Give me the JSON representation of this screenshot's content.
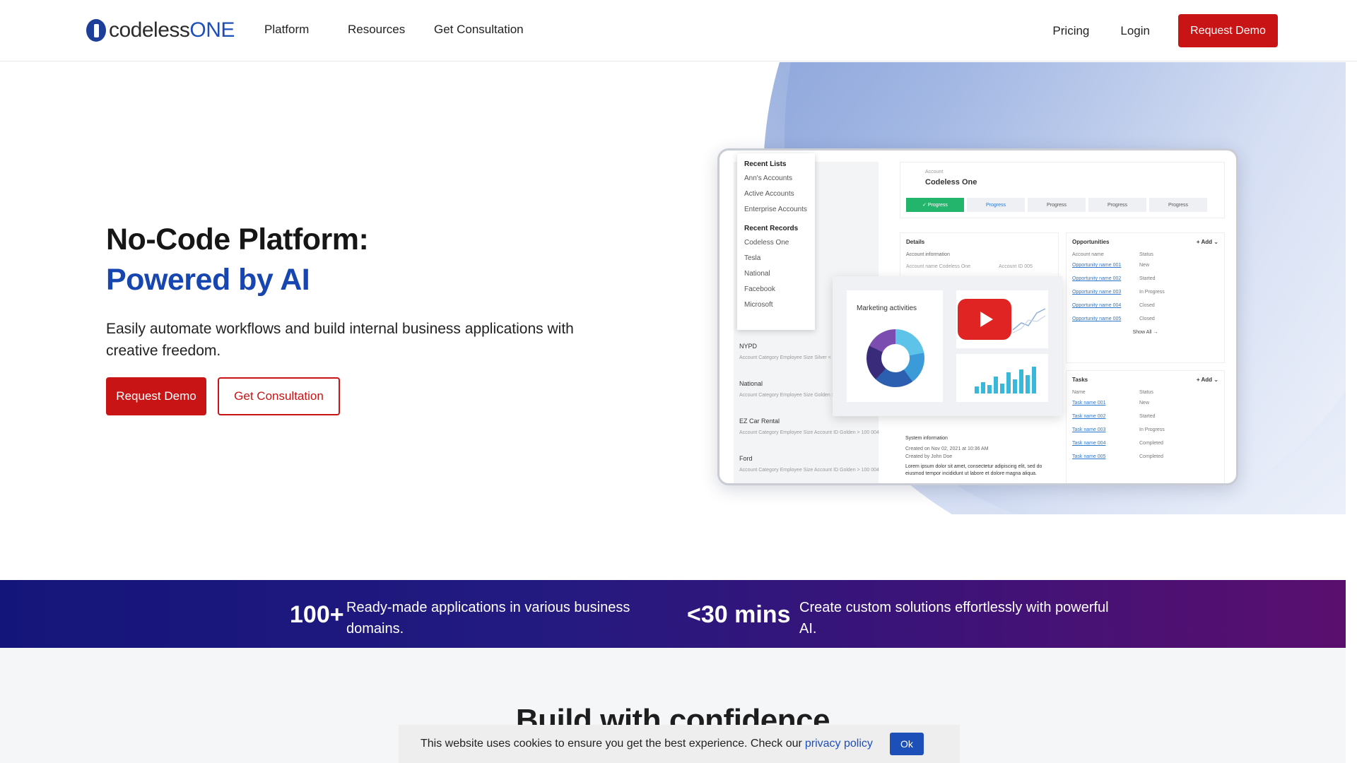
{
  "header": {
    "logo_part1": "codeless",
    "logo_part2": "ONE",
    "nav": [
      "Platform",
      "Resources",
      "Get Consultation"
    ],
    "pricing": "Pricing",
    "login": "Login",
    "request_demo": "Request Demo"
  },
  "hero": {
    "title_line1": "No-Code Platform:",
    "title_line2": "Powered by AI",
    "description": "Easily automate workflows and build internal business applications with creative freedom.",
    "cta_primary": "Request Demo",
    "cta_secondary": "Get Consultation"
  },
  "mockup": {
    "recent_lists_heading": "Recent Lists",
    "recent_lists": [
      "Ann's Accounts",
      "Active Accounts",
      "Enterprise Accounts"
    ],
    "recent_records_heading": "Recent Records",
    "recent_records": [
      "Codeless One",
      "Tesla",
      "National",
      "Facebook",
      "Microsoft"
    ],
    "left_rows": [
      {
        "name": "NYPD",
        "meta": "Account Category  Employee Size   Silver   < 50"
      },
      {
        "name": "National",
        "meta": "Account Category  Employee Size   Golden   > 100"
      },
      {
        "name": "EZ Car Rental",
        "meta": "Account Category  Employee Size  Account ID   Golden  > 100  004"
      },
      {
        "name": "Ford",
        "meta": "Account Category  Employee Size  Account ID   Golden  > 100  004"
      }
    ],
    "account_label": "Account",
    "account_name": "Codeless One",
    "steps": [
      "✓ Progress",
      "Progress",
      "Progress",
      "Progress",
      "Progress"
    ],
    "details_heading": "Details",
    "details_sub": "Account information",
    "details_fields": [
      "Account name  Codeless One",
      "Account ID  005"
    ],
    "system_info": "System information",
    "created_on": "Created on  Nov 02, 2021 at 10:36 AM",
    "created_by": "Created by  John Doe",
    "long_text": "Lorem ipsum dolor sit amet, consectetur adipiscing elit, sed do eiusmod tempor incididunt ut labore et dolore magna aliqua.",
    "opportunities_heading": "Opportunities",
    "add_label": "+ Add ⌄",
    "opp_cols": [
      "Account name",
      "Status"
    ],
    "opportunities": [
      {
        "name": "Opportunity name 001",
        "status": "New"
      },
      {
        "name": "Opportunity name 002",
        "status": "Started"
      },
      {
        "name": "Opportunity name 003",
        "status": "In Progress"
      },
      {
        "name": "Opportunity name 004",
        "status": "Closed"
      },
      {
        "name": "Opportunity name 005",
        "status": "Closed"
      }
    ],
    "show_all": "Show All →",
    "tasks_heading": "Tasks",
    "task_cols": [
      "Name",
      "Status"
    ],
    "tasks": [
      {
        "name": "Task name 001",
        "status": "New"
      },
      {
        "name": "Task name 002",
        "status": "Started"
      },
      {
        "name": "Task name 003",
        "status": "In Progress"
      },
      {
        "name": "Task name 004",
        "status": "Completed"
      },
      {
        "name": "Task name 005",
        "status": "Completed"
      }
    ],
    "marketing_title": "Marketing activities"
  },
  "stats": [
    {
      "number": "100+",
      "text": "Ready-made applications in various business domains."
    },
    {
      "number": "<30 mins",
      "text": "Create custom solutions effortlessly with powerful AI."
    }
  ],
  "section_title": "Build with confidence",
  "cookie": {
    "text": "This website uses cookies to ensure you get the best experience. Check our",
    "link": "privacy policy",
    "ok": "Ok"
  },
  "colors": {
    "brand_blue": "#1d4fb8",
    "brand_red": "#c81414",
    "band_start": "#14157a",
    "band_end": "#5a0f6e"
  }
}
